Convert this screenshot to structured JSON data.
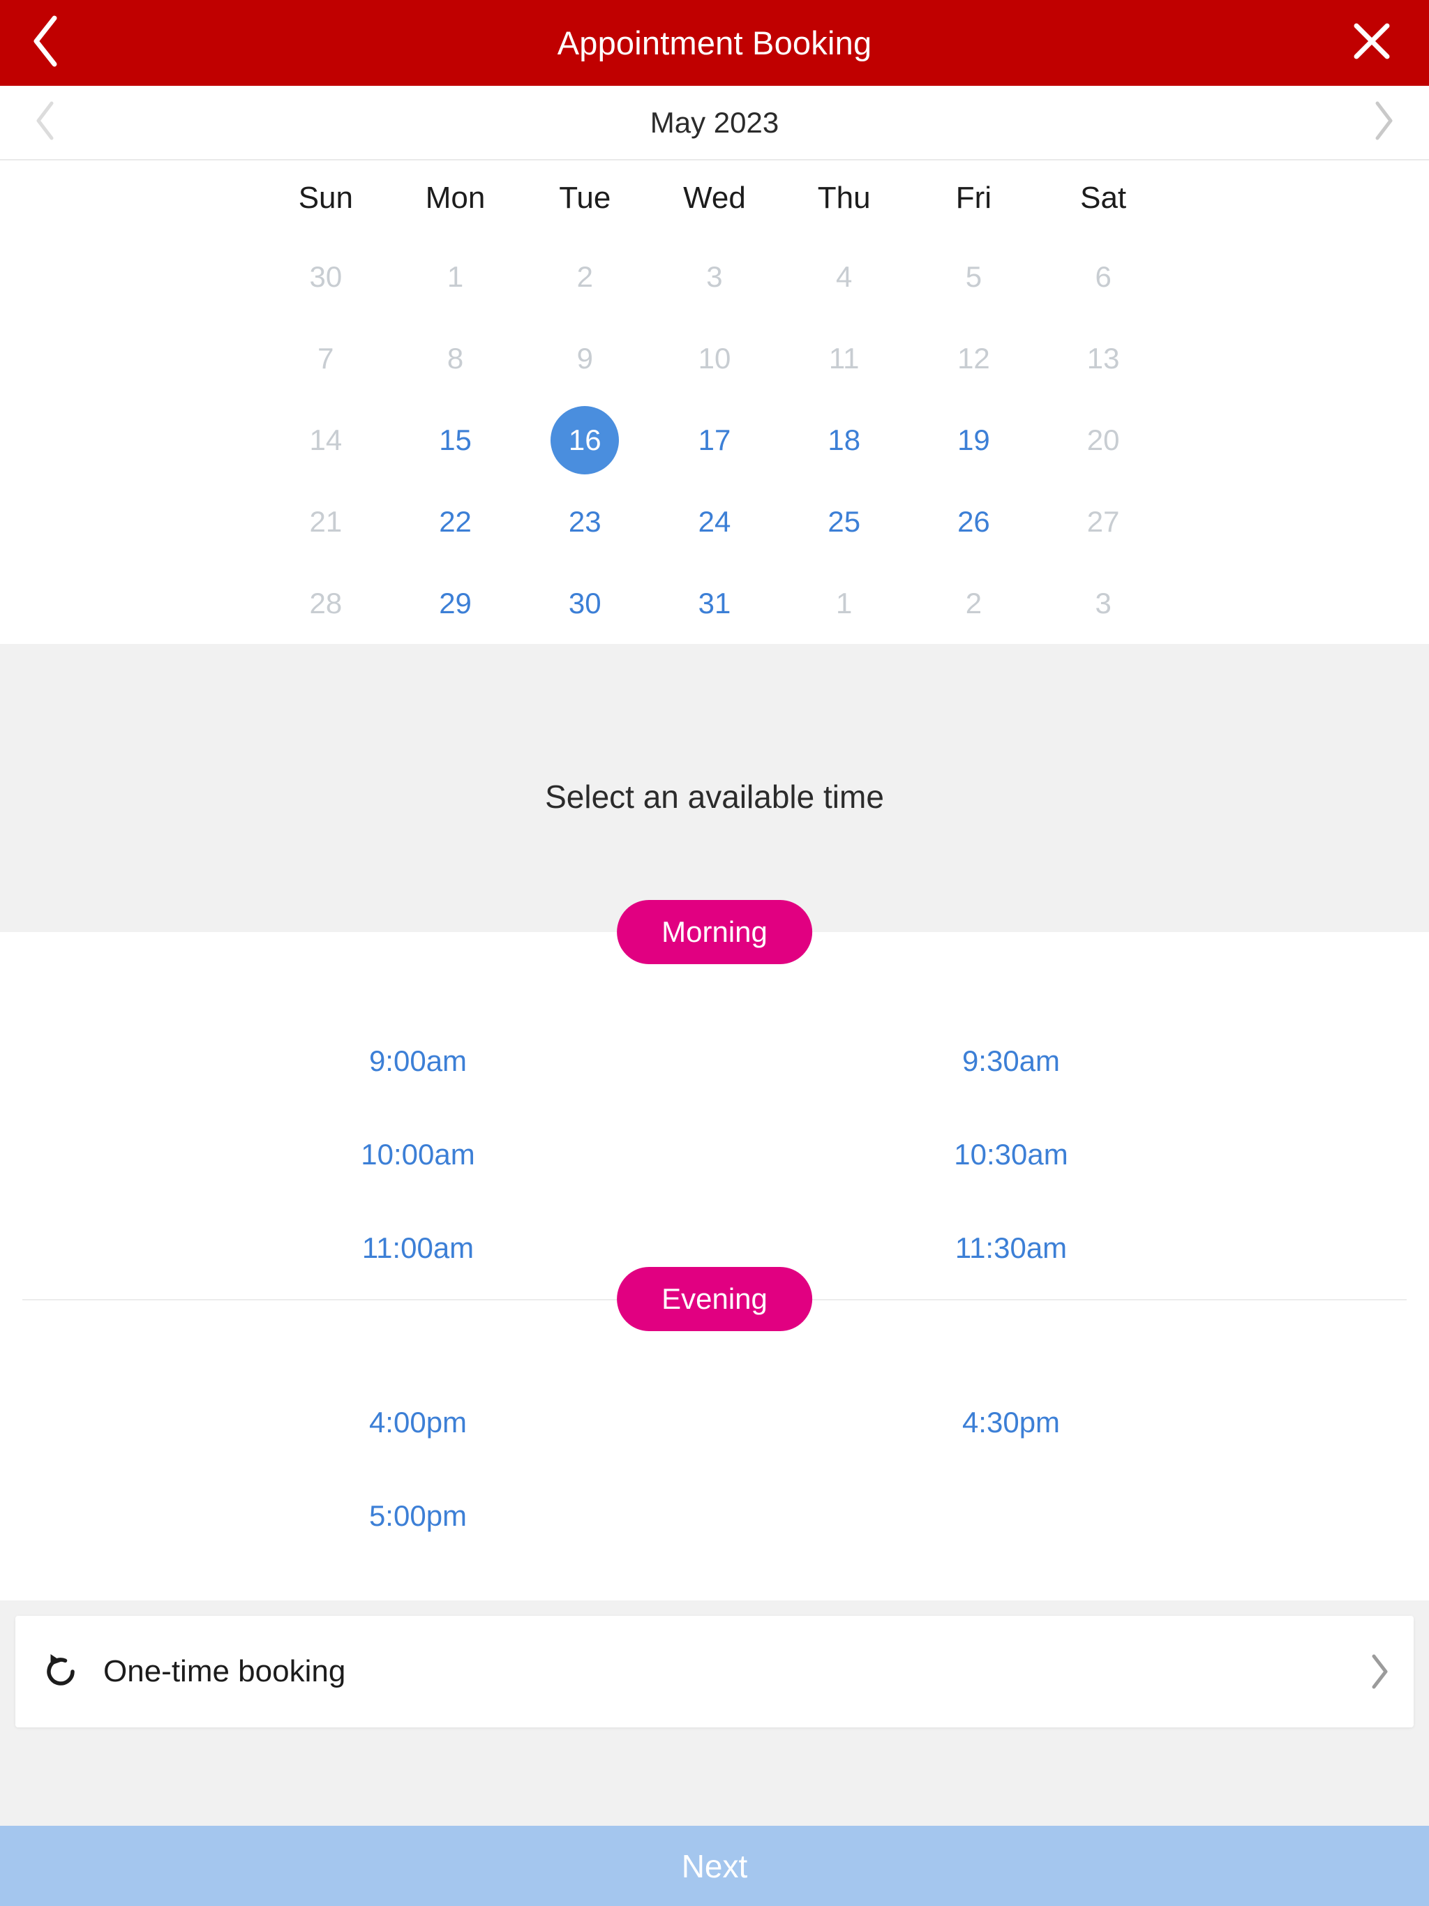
{
  "header": {
    "title": "Appointment Booking",
    "back_icon": "chevron-left-icon",
    "close_icon": "close-icon",
    "background_color": "#C00000",
    "text_color": "#FFFFFF"
  },
  "month_nav": {
    "label": "May 2023",
    "prev_icon": "chevron-left-icon",
    "next_icon": "chevron-right-icon"
  },
  "calendar": {
    "day_headers": [
      "Sun",
      "Mon",
      "Tue",
      "Wed",
      "Thu",
      "Fri",
      "Sat"
    ],
    "selected_day": "16",
    "selected_color": "#4A8EDE",
    "enabled_color": "#3C7FD6",
    "disabled_color": "#C8CDD2",
    "weeks": [
      [
        {
          "label": "30",
          "state": "disabled"
        },
        {
          "label": "1",
          "state": "disabled"
        },
        {
          "label": "2",
          "state": "disabled"
        },
        {
          "label": "3",
          "state": "disabled"
        },
        {
          "label": "4",
          "state": "disabled"
        },
        {
          "label": "5",
          "state": "disabled"
        },
        {
          "label": "6",
          "state": "disabled"
        }
      ],
      [
        {
          "label": "7",
          "state": "disabled"
        },
        {
          "label": "8",
          "state": "disabled"
        },
        {
          "label": "9",
          "state": "disabled"
        },
        {
          "label": "10",
          "state": "disabled"
        },
        {
          "label": "11",
          "state": "disabled"
        },
        {
          "label": "12",
          "state": "disabled"
        },
        {
          "label": "13",
          "state": "disabled"
        }
      ],
      [
        {
          "label": "14",
          "state": "disabled"
        },
        {
          "label": "15",
          "state": "enabled"
        },
        {
          "label": "16",
          "state": "selected"
        },
        {
          "label": "17",
          "state": "enabled"
        },
        {
          "label": "18",
          "state": "enabled"
        },
        {
          "label": "19",
          "state": "enabled"
        },
        {
          "label": "20",
          "state": "disabled"
        }
      ],
      [
        {
          "label": "21",
          "state": "disabled"
        },
        {
          "label": "22",
          "state": "enabled"
        },
        {
          "label": "23",
          "state": "enabled"
        },
        {
          "label": "24",
          "state": "enabled"
        },
        {
          "label": "25",
          "state": "enabled"
        },
        {
          "label": "26",
          "state": "enabled"
        },
        {
          "label": "27",
          "state": "disabled"
        }
      ],
      [
        {
          "label": "28",
          "state": "disabled"
        },
        {
          "label": "29",
          "state": "enabled"
        },
        {
          "label": "30",
          "state": "enabled"
        },
        {
          "label": "31",
          "state": "enabled"
        },
        {
          "label": "1",
          "state": "disabled"
        },
        {
          "label": "2",
          "state": "disabled"
        },
        {
          "label": "3",
          "state": "disabled"
        }
      ]
    ]
  },
  "time_section": {
    "title": "Select an available time",
    "pill_color": "#E10081",
    "groups": [
      {
        "label": "Morning",
        "slots": [
          "9:00am",
          "9:30am",
          "10:00am",
          "10:30am",
          "11:00am",
          "11:30am"
        ]
      },
      {
        "label": "Evening",
        "slots": [
          "4:00pm",
          "4:30pm",
          "5:00pm"
        ]
      }
    ]
  },
  "booking_row": {
    "icon": "repeat-icon",
    "label": "One-time booking",
    "chevron_icon": "chevron-right-icon"
  },
  "footer": {
    "next_label": "Next",
    "next_color": "#A4C6EE",
    "next_text_color": "#FFFFFF"
  }
}
